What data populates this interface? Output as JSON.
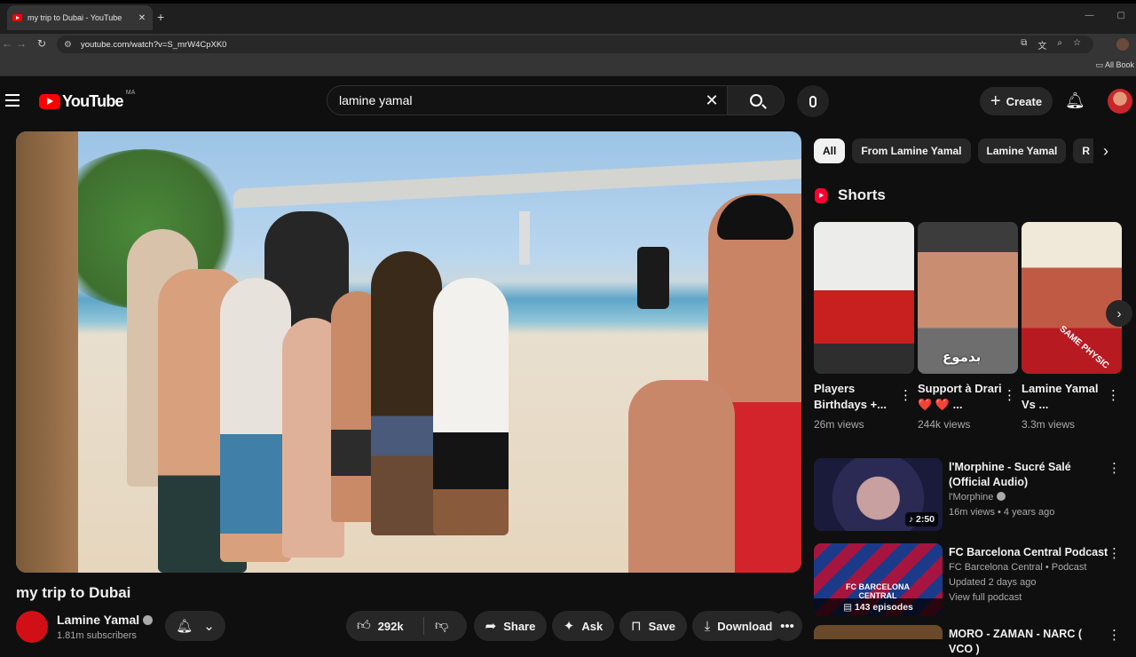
{
  "browser": {
    "tab_title": "my trip to Dubai - YouTube",
    "tab_close": "✕",
    "new_tab": "+",
    "url": "youtube.com/watch?v=S_mrW4CpXK0",
    "bookmarks_label": "All Book"
  },
  "header": {
    "logo_text": "YouTube",
    "country_code": "MA",
    "search_query": "lamine yamal",
    "create_label": "Create"
  },
  "video": {
    "title": "my trip to Dubai",
    "channel_name": "Lamine Yamal",
    "subscribers": "1.81m subscribers",
    "likes": "292k",
    "share_label": "Share",
    "ask_label": "Ask",
    "save_label": "Save",
    "download_label": "Download"
  },
  "chips": [
    "All",
    "From Lamine Yamal",
    "Lamine Yamal",
    "R"
  ],
  "shorts": {
    "heading": "Shorts",
    "items": [
      {
        "title": "Players Birthdays +...",
        "views": "26m views"
      },
      {
        "title": "Support à Drari ❤️ ❤️ ...",
        "views": "244k views",
        "overlay": "بدموع"
      },
      {
        "title": "Lamine Yamal Vs ...",
        "views": "3.3m views",
        "overlay": "SAME PHYSIC"
      }
    ]
  },
  "recommendations": [
    {
      "title": "l'Morphine - Sucré Salé (Official Audio)",
      "channel": "l'Morphine",
      "stats": "16m views • 4 years ago",
      "duration": "2:50"
    },
    {
      "title": "FC Barcelona Central Podcast",
      "channel": "FC Barcelona Central • Podcast",
      "stats": "Updated 2 days ago",
      "extra": "View full podcast",
      "episodes": "143 episodes",
      "thumb_text": "FC BARCELONA CENTRAL"
    },
    {
      "title": "MORO - ZAMAN - NARC ( VCO )"
    }
  ],
  "colors": {
    "background": "#0f0f0f",
    "accent": "#ff0000",
    "pill": "#272727"
  }
}
